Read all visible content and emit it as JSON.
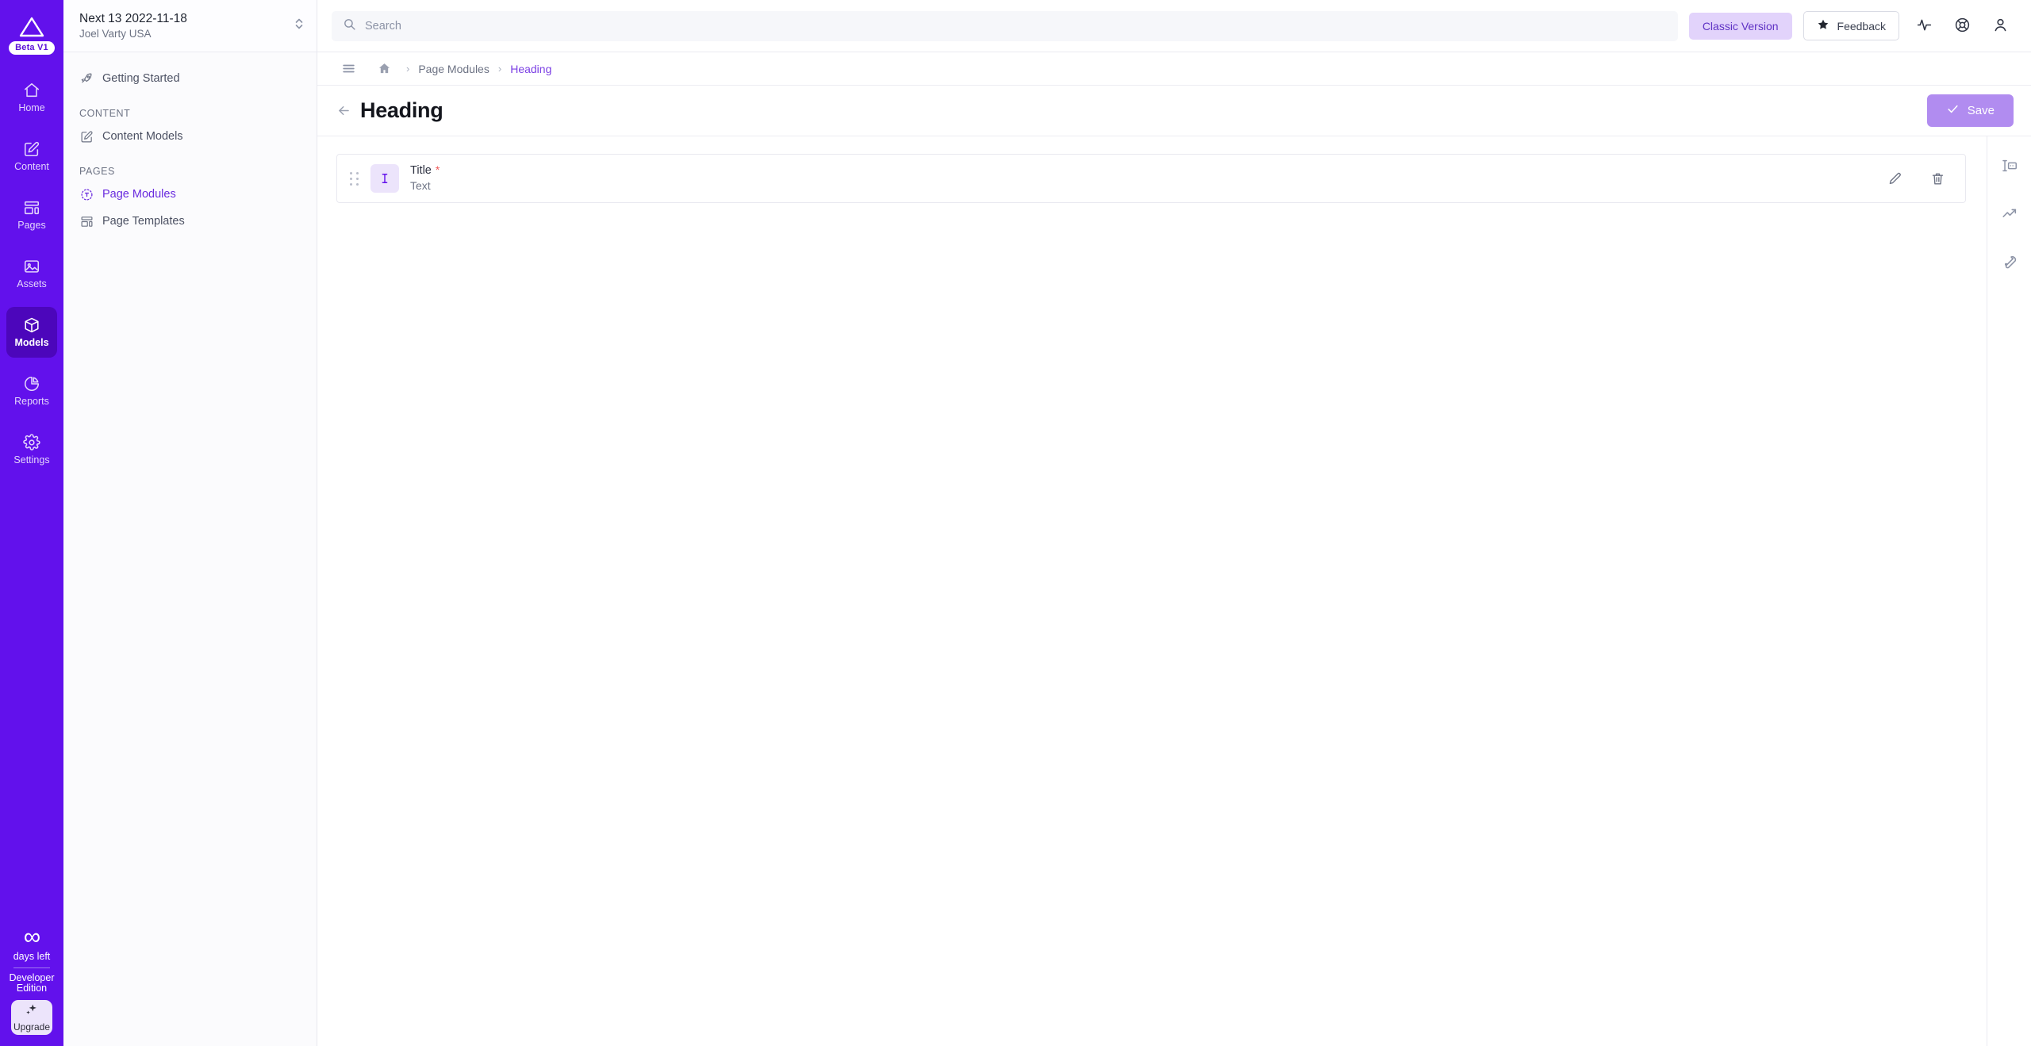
{
  "brand": {
    "logo_icon": "agility-triangle-logo",
    "beta_badge": "Beta V1",
    "primary_purple": "#6211ec",
    "active_purple": "#4c06bb",
    "accent_purple": "#7b3fe4"
  },
  "railnav": {
    "items": [
      {
        "label": "Home",
        "icon": "home-icon",
        "active": false
      },
      {
        "label": "Content",
        "icon": "content-edit-icon",
        "active": false
      },
      {
        "label": "Pages",
        "icon": "pages-layout-icon",
        "active": false
      },
      {
        "label": "Assets",
        "icon": "assets-image-icon",
        "active": false
      },
      {
        "label": "Models",
        "icon": "models-cube-icon",
        "active": true
      },
      {
        "label": "Reports",
        "icon": "reports-piechart-icon",
        "active": false
      },
      {
        "label": "Settings",
        "icon": "settings-gear-icon",
        "active": false
      }
    ],
    "footer": {
      "infinity_symbol": "∞",
      "days_left": "days left",
      "edition_line1": "Developer",
      "edition_line2": "Edition",
      "upgrade_label": "Upgrade",
      "upgrade_icon": "sparkle-icon"
    }
  },
  "sidebar": {
    "project": {
      "name": "Next 13 2022-11-18",
      "org": "Joel Varty USA",
      "switcher_icon": "chevron-up-down-icon"
    },
    "getting_started": {
      "label": "Getting Started",
      "icon": "rocket-icon"
    },
    "groups": [
      {
        "title": "CONTENT",
        "items": [
          {
            "label": "Content Models",
            "icon": "content-models-icon",
            "active": false
          }
        ]
      },
      {
        "title": "PAGES",
        "items": [
          {
            "label": "Page Modules",
            "icon": "page-modules-icon",
            "active": true
          },
          {
            "label": "Page Templates",
            "icon": "page-templates-icon",
            "active": false
          }
        ]
      }
    ]
  },
  "topbar": {
    "search": {
      "value": "",
      "placeholder": "Search",
      "icon": "search-icon"
    },
    "classic_version_label": "Classic Version",
    "feedback_label": "Feedback",
    "feedback_icon": "star-icon",
    "activity_icon": "activity-pulse-icon",
    "help_icon": "lifebuoy-help-icon",
    "account_icon": "user-account-icon"
  },
  "breadcrumb": {
    "menu_icon": "hamburger-menu-icon",
    "home_icon": "home-filled-icon",
    "separator": "›",
    "items": [
      {
        "label": "Page Modules",
        "current": false
      },
      {
        "label": "Heading",
        "current": true
      }
    ]
  },
  "page": {
    "back_icon": "arrow-left-icon",
    "title": "Heading",
    "save_label": "Save",
    "save_icon": "check-icon"
  },
  "fields": [
    {
      "drag_handle_icon": "drag-dots-icon",
      "type_icon": "text-cursor-icon",
      "name": "Title",
      "required_marker": "*",
      "type": "Text",
      "edit_icon": "pencil-edit-icon",
      "delete_icon": "trash-delete-icon"
    }
  ],
  "rightrail": {
    "tools": [
      {
        "icon": "form-fields-icon",
        "label": "Fields"
      },
      {
        "icon": "trending-up-icon",
        "label": "Analytics"
      },
      {
        "icon": "wrench-settings-icon",
        "label": "Settings"
      }
    ]
  }
}
